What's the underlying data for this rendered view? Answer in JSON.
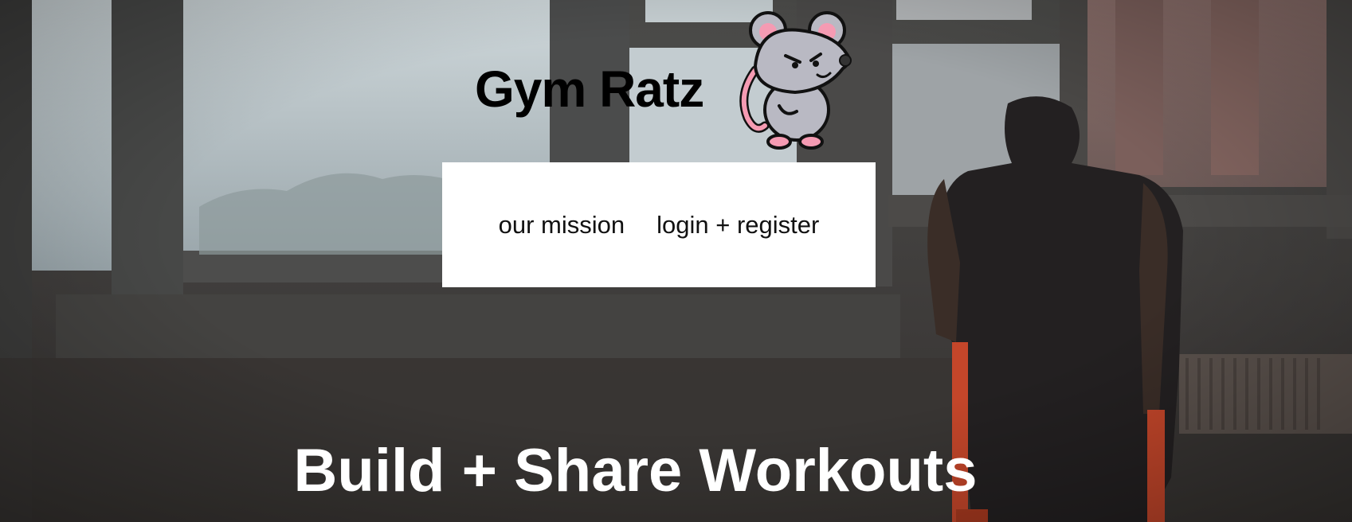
{
  "brand": {
    "title": "Gym Ratz",
    "mascot_icon": "rat-mascot-icon"
  },
  "nav": {
    "items": [
      {
        "label": "our mission"
      },
      {
        "label": "login + register"
      }
    ]
  },
  "hero": {
    "headline": "Build + Share Workouts",
    "background": "gym-window-photo"
  },
  "colors": {
    "nav_bg": "#ffffff",
    "brand_text": "#000000",
    "headline_text": "#ffffff",
    "mascot_gray": "#b9b9c3",
    "mascot_pink": "#f59bb3",
    "bar_red": "#c4462a"
  }
}
